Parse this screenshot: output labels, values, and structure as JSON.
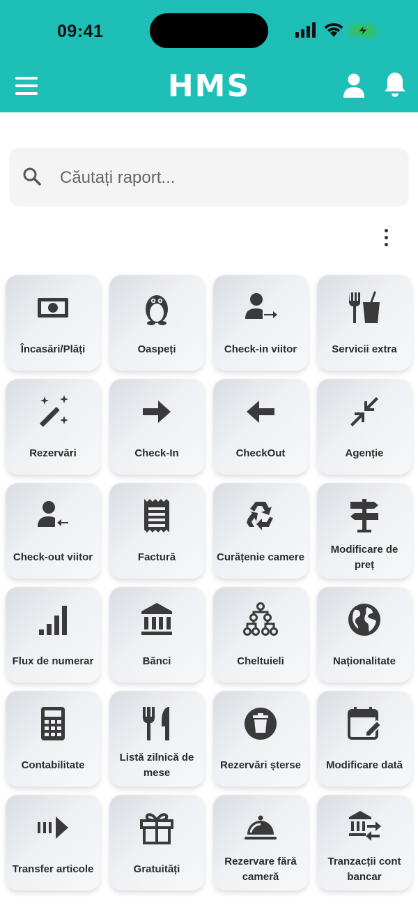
{
  "status_bar": {
    "time": "09:41"
  },
  "header": {
    "logo": "HMS"
  },
  "search": {
    "placeholder": "Căutați raport..."
  },
  "colors": {
    "header_bg": "#1dbfb7",
    "icon": "#3a3a3a",
    "battery_fill": "#35c25b"
  },
  "tiles": [
    {
      "label": "Încasări/Plăți",
      "icon": "money-icon"
    },
    {
      "label": "Oaspeți",
      "icon": "penguin-icon"
    },
    {
      "label": "Check-in viitor",
      "icon": "person-arrow-right-icon"
    },
    {
      "label": "Servicii extra",
      "icon": "fork-drink-icon"
    },
    {
      "label": "Rezervări",
      "icon": "magic-wand-icon"
    },
    {
      "label": "Check-In",
      "icon": "arrow-right-icon"
    },
    {
      "label": "CheckOut",
      "icon": "arrow-left-icon"
    },
    {
      "label": "Agenție",
      "icon": "collapse-arrows-icon"
    },
    {
      "label": "Check-out viitor",
      "icon": "person-arrow-left-icon"
    },
    {
      "label": "Factură",
      "icon": "receipt-icon"
    },
    {
      "label": "Curățenie camere",
      "icon": "recycle-icon"
    },
    {
      "label": "Modificare de preț",
      "icon": "signpost-icon"
    },
    {
      "label": "Flux de numerar",
      "icon": "signal-bars-icon"
    },
    {
      "label": "Bănci",
      "icon": "bank-icon"
    },
    {
      "label": "Cheltuieli",
      "icon": "hierarchy-icon"
    },
    {
      "label": "Naționalitate",
      "icon": "globe-icon"
    },
    {
      "label": "Contabilitate",
      "icon": "calculator-icon"
    },
    {
      "label": "Listă zilnică de mese",
      "icon": "cutlery-icon"
    },
    {
      "label": "Rezervări șterse",
      "icon": "trash-circle-icon"
    },
    {
      "label": "Modificare dată",
      "icon": "calendar-edit-icon"
    },
    {
      "label": "Transfer articole",
      "icon": "transfer-arrow-icon"
    },
    {
      "label": "Gratuități",
      "icon": "gift-icon"
    },
    {
      "label": "Rezervare fără cameră",
      "icon": "cloche-icon"
    },
    {
      "label": "Tranzacții cont bancar",
      "icon": "bank-transfer-icon"
    }
  ]
}
